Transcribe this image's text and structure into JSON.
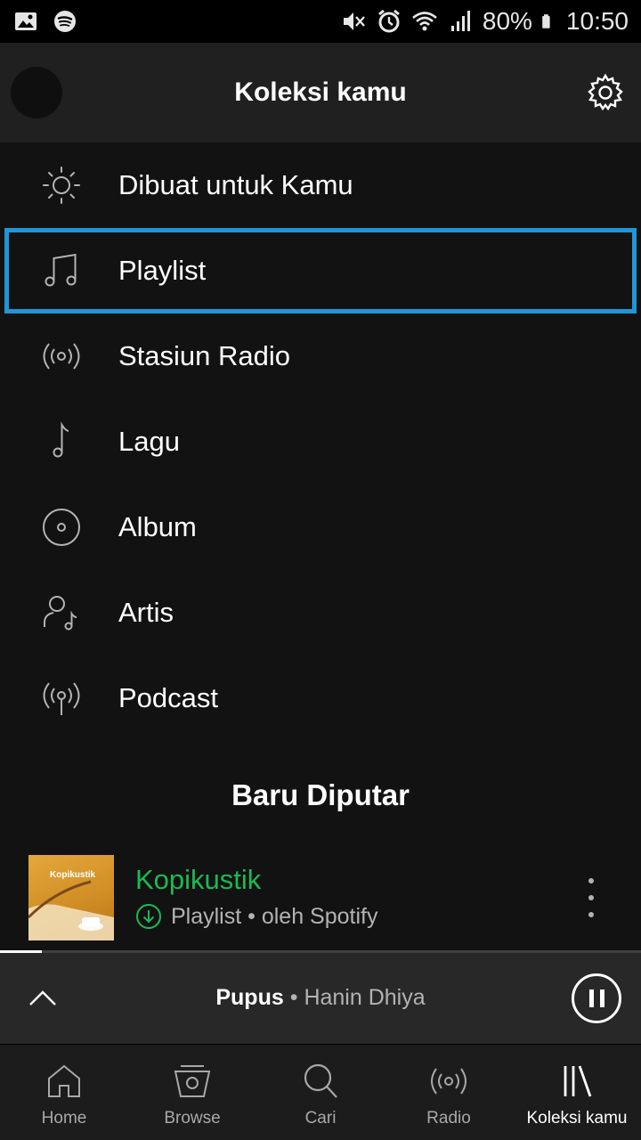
{
  "status_bar": {
    "battery": "80%",
    "time": "10:50",
    "icons": [
      "gallery-icon",
      "spotify-icon",
      "mute-icon",
      "alarm-icon",
      "wifi-icon",
      "signal-icon",
      "battery-icon"
    ]
  },
  "header": {
    "title": "Koleksi kamu",
    "avatar": "avatar",
    "settings_icon": "gear-icon"
  },
  "menu": {
    "items": [
      {
        "label": "Dibuat untuk Kamu",
        "icon": "sun-icon"
      },
      {
        "label": "Playlist",
        "icon": "music-notes-icon",
        "selected": true
      },
      {
        "label": "Stasiun Radio",
        "icon": "radio-icon"
      },
      {
        "label": "Lagu",
        "icon": "music-note-icon"
      },
      {
        "label": "Album",
        "icon": "album-icon"
      },
      {
        "label": "Artis",
        "icon": "artist-icon"
      },
      {
        "label": "Podcast",
        "icon": "podcast-icon"
      }
    ]
  },
  "recent": {
    "section_title": "Baru Diputar",
    "items": [
      {
        "cover_text": "Kopikustik",
        "title": "Kopikustik",
        "subtitle": "Playlist • oleh Spotify",
        "downloaded_icon": "download-check-icon"
      }
    ]
  },
  "now_playing": {
    "song": "Pupus",
    "separator": "•",
    "artist": "Hanin Dhiya",
    "progress": 0.065,
    "state_icon": "pause-icon"
  },
  "bottom_nav": {
    "items": [
      {
        "label": "Home",
        "icon": "home-icon"
      },
      {
        "label": "Browse",
        "icon": "browse-icon"
      },
      {
        "label": "Cari",
        "icon": "search-icon"
      },
      {
        "label": "Radio",
        "icon": "radio-icon"
      },
      {
        "label": "Koleksi kamu",
        "icon": "library-icon",
        "active": true
      }
    ]
  },
  "colors": {
    "accent_green": "#1db954",
    "selection_outline": "#1e97d8",
    "background": "#121212"
  }
}
